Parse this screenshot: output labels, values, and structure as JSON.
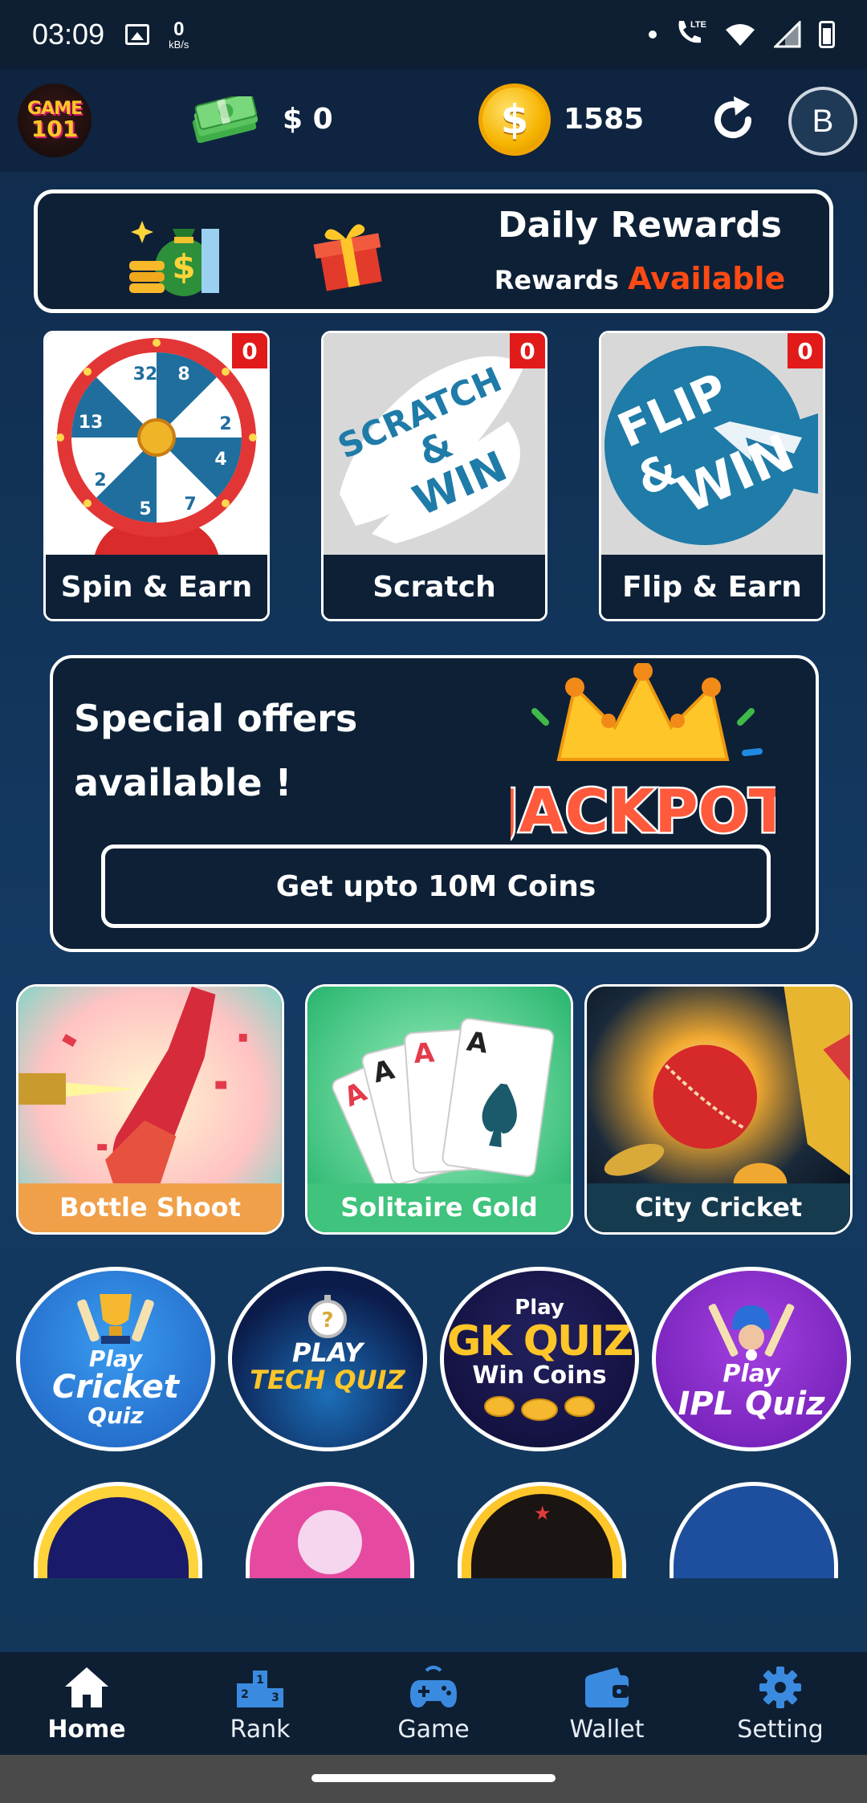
{
  "status_bar": {
    "time": "03:09",
    "net_speed_value": "0",
    "net_speed_unit": "kB/s",
    "network_type": "LTE",
    "battery_level": "71"
  },
  "header": {
    "logo_line1": "GAME",
    "logo_line2": "101",
    "cash_balance": "$ 0",
    "coin_symbol": "$",
    "coin_balance": "1585",
    "avatar_initial": "B"
  },
  "daily_rewards": {
    "title": "Daily Rewards",
    "subtitle_prefix": "Rewards",
    "subtitle_highlight": "Available"
  },
  "mini_games": [
    {
      "label": "Spin & Earn",
      "badge": "0"
    },
    {
      "label": "Scratch",
      "badge": "0",
      "art_text": [
        "SCRATCH",
        "&",
        "WIN"
      ]
    },
    {
      "label": "Flip & Earn",
      "badge": "0",
      "art_text": [
        "FLIP",
        "&",
        "WIN"
      ]
    }
  ],
  "special_offers": {
    "line1": "Special offers",
    "line2": "available !",
    "jackpot_text": "JACKPOT",
    "button_label": "Get upto 10M Coins"
  },
  "featured_games": [
    {
      "label": "Bottle Shoot"
    },
    {
      "label": "Solitaire Gold"
    },
    {
      "label": "City Cricket"
    }
  ],
  "quizzes": [
    {
      "line1": "Play",
      "line2": "Cricket",
      "line3": "Quiz"
    },
    {
      "line1": "PLAY",
      "line2": "TECH QUIZ"
    },
    {
      "line1": "Play",
      "line2": "GK QUIZ",
      "line3": "Win Coins"
    },
    {
      "line1": "Play",
      "line2": "IPL Quiz"
    }
  ],
  "bottom_nav": [
    {
      "label": "Home",
      "icon": "home-icon",
      "active": true
    },
    {
      "label": "Rank",
      "icon": "podium-icon",
      "active": false
    },
    {
      "label": "Game",
      "icon": "gamepad-icon",
      "active": false
    },
    {
      "label": "Wallet",
      "icon": "wallet-icon",
      "active": false
    },
    {
      "label": "Setting",
      "icon": "gear-icon",
      "active": false
    }
  ],
  "colors": {
    "background": "#143a63",
    "panel": "#0d2036",
    "accent_orange": "#ff4a14",
    "badge_red": "#e11a1a",
    "nav_icon_blue": "#3a8be0"
  }
}
